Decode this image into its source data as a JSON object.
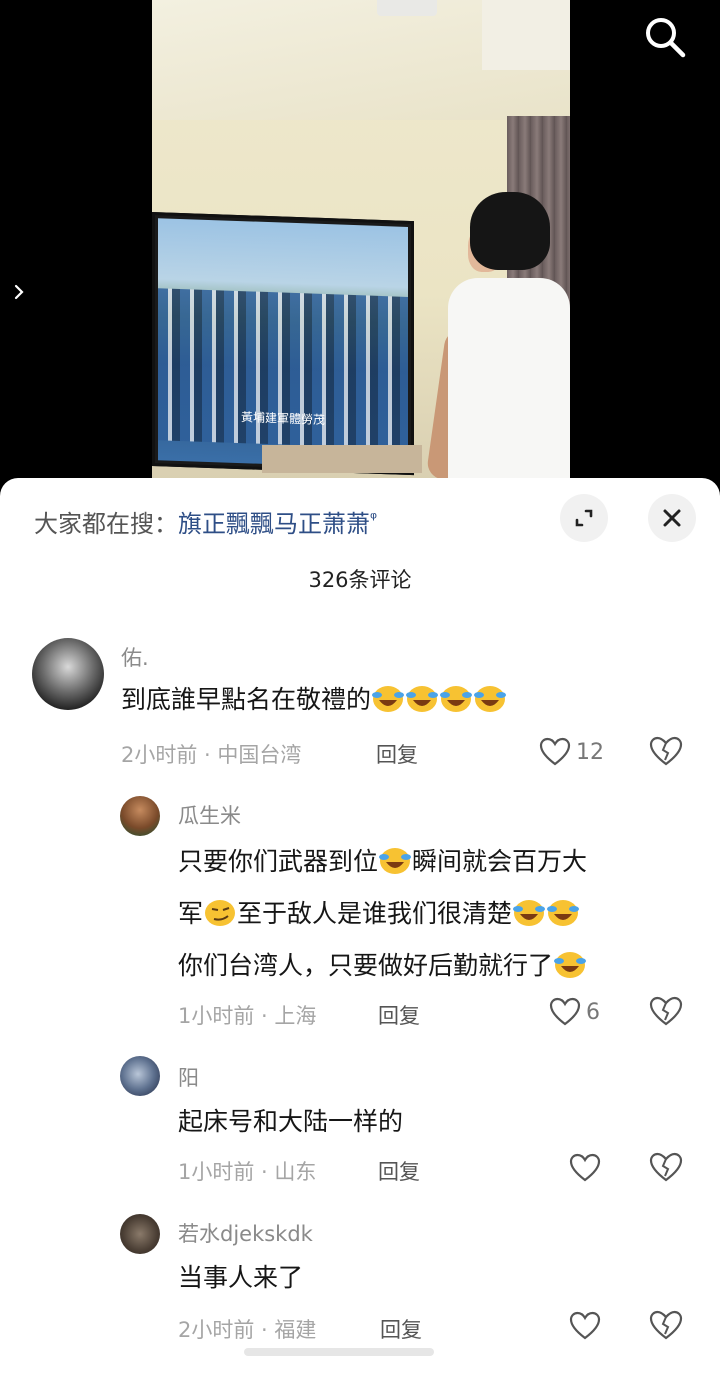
{
  "video": {
    "tv_caption": "黃埔建軍體勞茂"
  },
  "sheet": {
    "search_prefix": "大家都在搜：",
    "search_keyword": "旗正飄飄马正萧萧",
    "comment_count": "326条评论"
  },
  "comments": [
    {
      "user": "佑.",
      "text": "到底誰早點名在敬禮的",
      "time_location": "2小时前 · 中国台湾",
      "reply_label": "回复",
      "likes": "12"
    },
    {
      "user": "瓜生米",
      "text_line1a": "只要你们武器到位",
      "text_line1b": "瞬间就会百万大",
      "text_line2a": "军",
      "text_line2b": "至于敌人是谁我们很清楚",
      "text_line3": "你们台湾人，只要做好后勤就行了",
      "time_location": "1小时前 · 上海",
      "reply_label": "回复",
      "likes": "6"
    },
    {
      "user": "阳",
      "text": "起床号和大陆一样的",
      "time_location": "1小时前 · 山东",
      "reply_label": "回复"
    },
    {
      "user": "若水djekskdk",
      "text": "当事人来了",
      "time_location": "2小时前 · 福建",
      "reply_label": "回复"
    }
  ]
}
